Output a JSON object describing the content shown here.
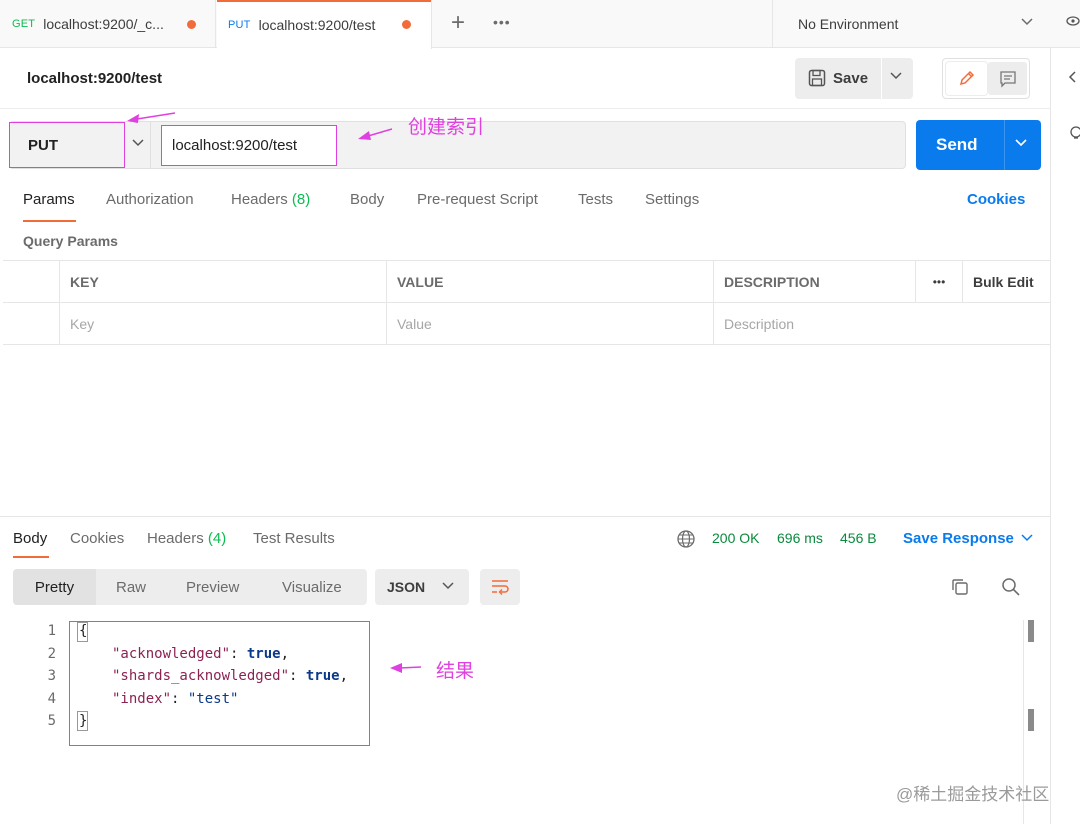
{
  "tabs": [
    {
      "method": "GET",
      "title": "localhost:9200/_c..."
    },
    {
      "method": "PUT",
      "title": "localhost:9200/test"
    }
  ],
  "tabs_more": "•••",
  "environment": "No Environment",
  "request": {
    "title": "localhost:9200/test",
    "save_label": "Save",
    "method": "PUT",
    "url": "localhost:9200/test",
    "send_label": "Send"
  },
  "annotations": {
    "create_index": "创建索引",
    "result": "结果"
  },
  "request_tabs": {
    "params": "Params",
    "authorization": "Authorization",
    "headers": "Headers",
    "headers_count": "(8)",
    "body": "Body",
    "pre_request": "Pre-request Script",
    "tests": "Tests",
    "settings": "Settings",
    "cookies": "Cookies"
  },
  "query_params": {
    "title": "Query Params",
    "headers": [
      "KEY",
      "VALUE",
      "DESCRIPTION"
    ],
    "more": "•••",
    "bulk_edit": "Bulk Edit",
    "placeholders": [
      "Key",
      "Value",
      "Description"
    ]
  },
  "response": {
    "tabs": {
      "body": "Body",
      "cookies": "Cookies",
      "headers": "Headers",
      "headers_count": "(4)",
      "test_results": "Test Results"
    },
    "status": "200 OK",
    "time": "696 ms",
    "size": "456 B",
    "save_response": "Save Response",
    "views": [
      "Pretty",
      "Raw",
      "Preview",
      "Visualize"
    ],
    "format": "JSON",
    "line_numbers": [
      "1",
      "2",
      "3",
      "4",
      "5"
    ],
    "json": {
      "open": "{",
      "close": "}",
      "entries": [
        {
          "key": "\"acknowledged\"",
          "value": "true",
          "kind": "bool",
          "comma": ","
        },
        {
          "key": "\"shards_acknowledged\"",
          "value": "true",
          "kind": "bool",
          "comma": ","
        },
        {
          "key": "\"index\"",
          "value": "\"test\"",
          "kind": "string",
          "comma": ""
        }
      ]
    }
  },
  "watermark": "@稀土掘金技术社区",
  "colors": {
    "accent_orange": "#f26b3a",
    "send_blue": "#097bed",
    "status_green": "#0cbb52",
    "annotation_magenta": "#e040e0"
  }
}
